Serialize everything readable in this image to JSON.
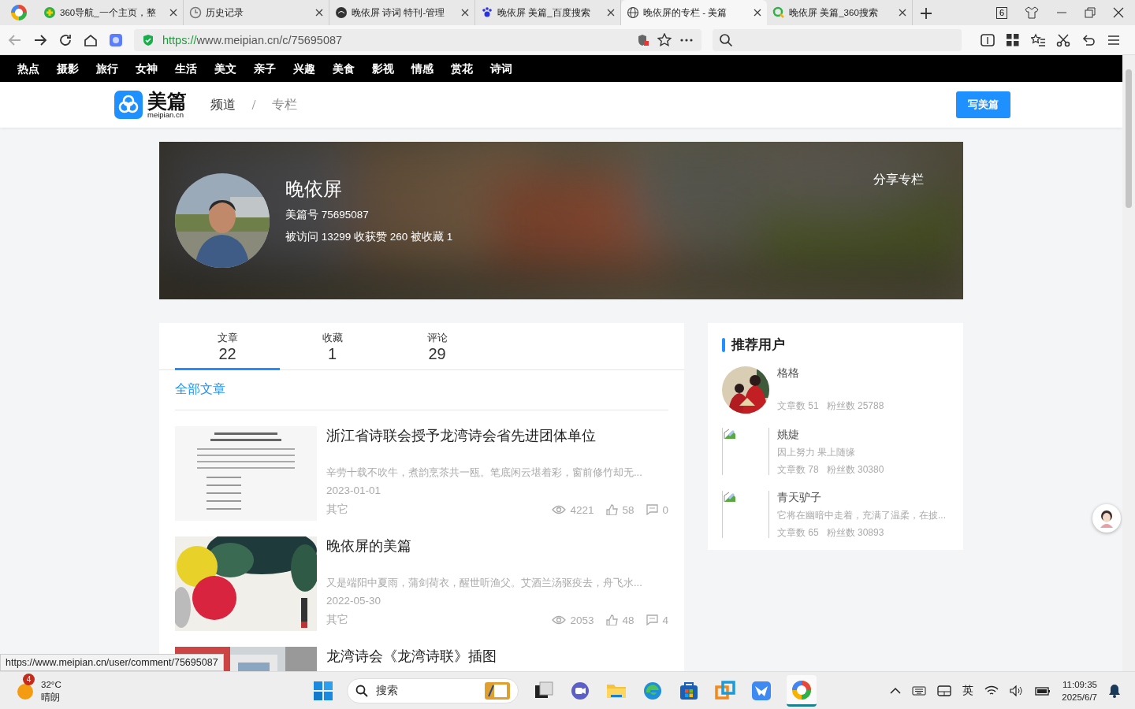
{
  "browser": {
    "tabs": [
      {
        "title": "360导航_一个主页，整",
        "selected": false
      },
      {
        "title": "历史记录",
        "selected": false
      },
      {
        "title": "晚依屏 诗词 特刊-管理",
        "selected": false
      },
      {
        "title": "晚依屏 美篇_百度搜索",
        "selected": false
      },
      {
        "title": "晚依屏的专栏 - 美篇",
        "selected": true
      },
      {
        "title": "晚依屏 美篇_360搜索",
        "selected": false
      }
    ],
    "tab_count": "6",
    "url_scheme": "https://",
    "url_rest": "www.meipian.cn/c/75695087"
  },
  "nav_items": [
    "热点",
    "摄影",
    "旅行",
    "女神",
    "生活",
    "美文",
    "亲子",
    "兴趣",
    "美食",
    "影视",
    "情感",
    "赏花",
    "诗词"
  ],
  "header": {
    "logo_name": "美篇",
    "logo_domain": "meipian.cn",
    "breadcrumb": [
      "频道",
      "专栏"
    ],
    "write_button": "写美篇"
  },
  "profile": {
    "name": "晚依屏",
    "id_line": "美篇号 75695087",
    "stats_line": "被访问 13299 收获赞 260 被收藏 1",
    "share": "分享专栏"
  },
  "tabs": [
    {
      "label": "文章",
      "count": "22",
      "selected": true
    },
    {
      "label": "收藏",
      "count": "1",
      "selected": false
    },
    {
      "label": "评论",
      "count": "29",
      "selected": false
    }
  ],
  "filter": "全部文章",
  "articles": [
    {
      "title": "浙江省诗联会授予龙湾诗会省先进团体单位",
      "excerpt": "辛劳十载不吹牛，煮韵烹茶共一瓯。笔底闲云堪着彩，窗前修竹却无...",
      "date": "2023-01-01",
      "category": "其它",
      "views": "4221",
      "likes": "58",
      "comments": "0"
    },
    {
      "title": "晚依屏的美篇",
      "excerpt": "又是端阳中夏雨，蒲剑荷衣，醒世听渔父。艾酒兰汤驱疫去，舟飞水...",
      "date": "2022-05-30",
      "category": "其它",
      "views": "2053",
      "likes": "48",
      "comments": "4"
    },
    {
      "title": "龙湾诗会《龙湾诗联》插图"
    }
  ],
  "recommended": {
    "title": "推荐用户",
    "users": [
      {
        "name": "格格",
        "kind": "picture",
        "articles": "文章数 51",
        "fans": "粉丝数 25788"
      },
      {
        "name": "姚婕",
        "kind": "broken",
        "bio": "因上努力 果上随缘",
        "articles": "文章数 78",
        "fans": "粉丝数 30380"
      },
      {
        "name": "青天驴子",
        "kind": "broken",
        "bio": "它将在幽暗中走着，充满了温柔，在披...",
        "articles": "文章数 65",
        "fans": "粉丝数 30893"
      }
    ]
  },
  "status_url": "https://www.meipian.cn/user/comment/75695087",
  "taskbar": {
    "weather_badge": "4",
    "temperature": "32°C",
    "weather": "晴朗",
    "search_placeholder": "搜索",
    "ime": "英",
    "time": "11:09:35",
    "date": "2025/6/7"
  }
}
